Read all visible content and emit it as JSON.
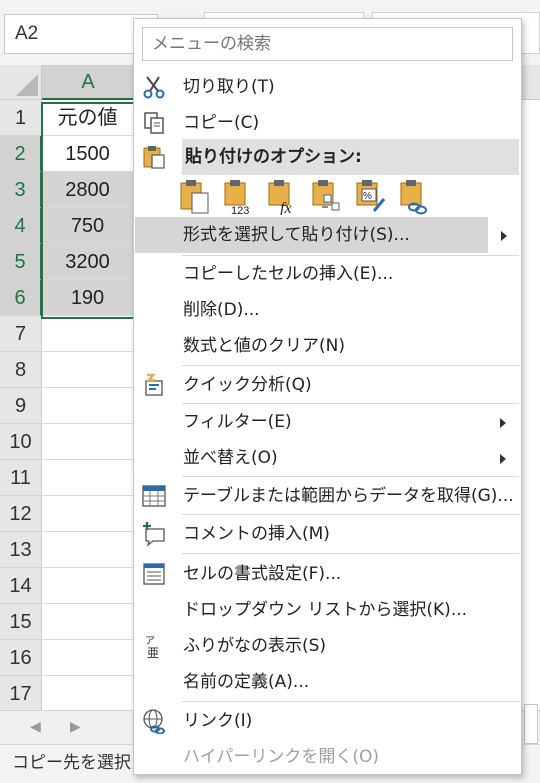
{
  "excel": {
    "namebox": "A2",
    "column_header": "A",
    "row_numbers": [
      "1",
      "2",
      "3",
      "4",
      "5",
      "6",
      "7",
      "8",
      "9",
      "10",
      "11",
      "12",
      "13",
      "14",
      "15",
      "16",
      "17"
    ],
    "cells": [
      "元の値",
      "1500",
      "2800",
      "750",
      "3200",
      "190"
    ],
    "status_text": "コピー先を選択し"
  },
  "menu": {
    "search_placeholder": "メニューの検索",
    "cut": "切り取り(T)",
    "copy": "コピー(C)",
    "paste_options": "貼り付けのオプション:",
    "paste_special": "形式を選択して貼り付け(S)...",
    "insert_copied": "コピーしたセルの挿入(E)...",
    "delete": "削除(D)...",
    "clear": "数式と値のクリア(N)",
    "quick_analysis": "クイック分析(Q)",
    "filter": "フィルター(E)",
    "sort": "並べ替え(O)",
    "get_data": "テーブルまたは範囲からデータを取得(G)...",
    "insert_comment": "コメントの挿入(M)",
    "format_cells": "セルの書式設定(F)...",
    "pick_list": "ドロップダウン リストから選択(K)...",
    "phonetic": "ふりがなの表示(S)",
    "define_name": "名前の定義(A)...",
    "link": "リンク(I)",
    "open_hyperlink": "ハイパーリンクを開く(O)"
  },
  "colors": {
    "excel_green": "#217346",
    "icon_gold": "#e8b04a",
    "icon_blue": "#2b6cb0",
    "highlight": "#d6d6d6"
  }
}
